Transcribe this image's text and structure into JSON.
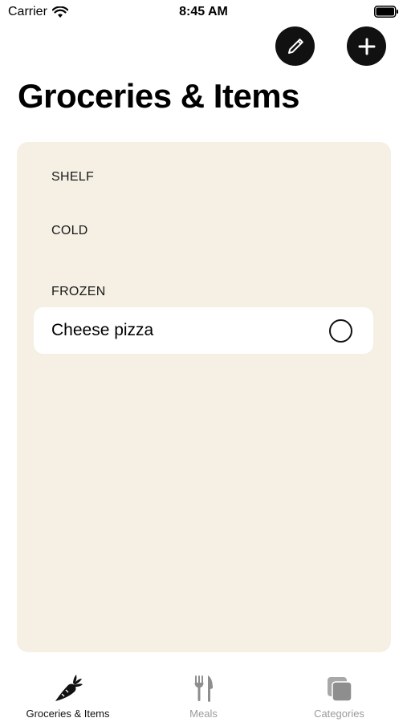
{
  "status_bar": {
    "carrier": "Carrier",
    "time": "8:45 AM"
  },
  "header": {
    "title": "Groceries & Items",
    "edit_icon": "pencil-icon",
    "add_icon": "plus-icon"
  },
  "sections": [
    {
      "label": "SHELF",
      "items": []
    },
    {
      "label": "COLD",
      "items": []
    },
    {
      "label": "FROZEN",
      "items": [
        {
          "label": "Cheese pizza",
          "checked": false
        }
      ]
    }
  ],
  "tab_bar": {
    "tabs": [
      {
        "label": "Groceries & Items",
        "icon": "carrot-icon",
        "active": true
      },
      {
        "label": "Meals",
        "icon": "fork-knife-icon",
        "active": false
      },
      {
        "label": "Categories",
        "icon": "stacked-squares-icon",
        "active": false
      }
    ]
  },
  "colors": {
    "card_background": "#f5efe4",
    "button_background": "#111111",
    "inactive_tab": "#9a9a9a"
  }
}
